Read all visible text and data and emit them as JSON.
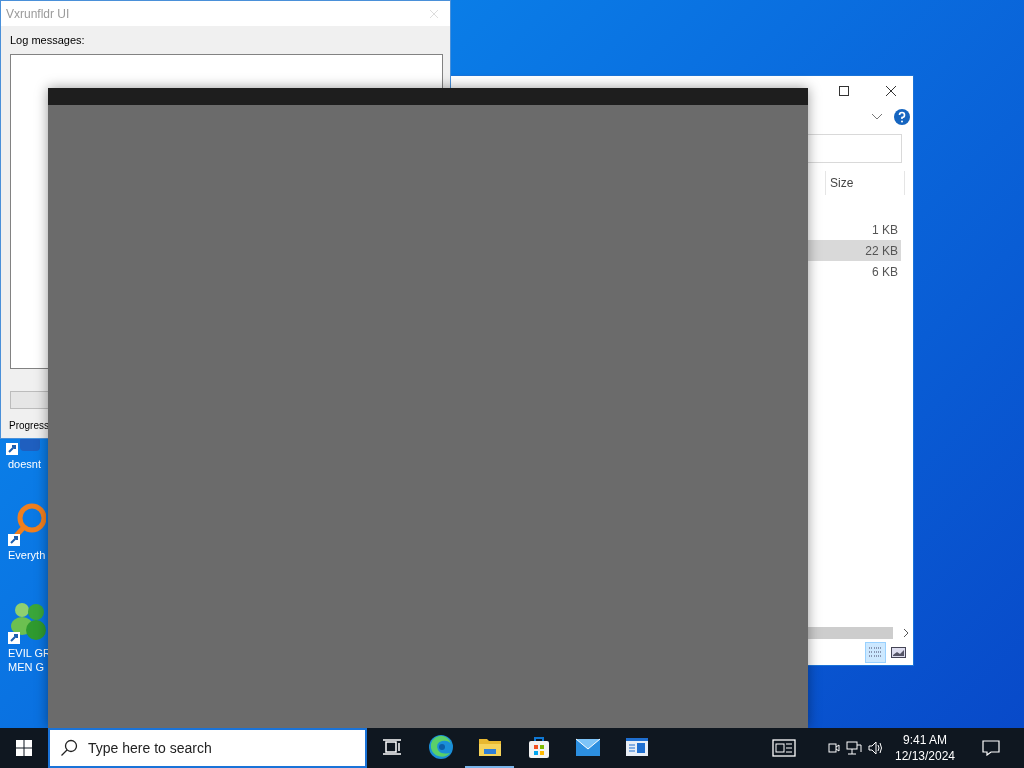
{
  "desktop_icons": [
    {
      "lines": [
        "doesnt"
      ],
      "kind": "blue"
    },
    {
      "lines": [
        "Everyth"
      ],
      "kind": "search"
    },
    {
      "lines": [
        "EVIL GR",
        "MEN G"
      ],
      "kind": "people"
    }
  ],
  "log_window": {
    "title": "Vxrunfldr UI",
    "log_label": "Log messages:",
    "progress_label": "Progress"
  },
  "explorer": {
    "column": "Size",
    "rows": [
      {
        "size": "1 KB",
        "selected": false
      },
      {
        "size": "22 KB",
        "selected": true
      },
      {
        "size": "6 KB",
        "selected": false
      }
    ],
    "views": [
      {
        "kind": "details",
        "selected": true
      },
      {
        "kind": "thumbnails",
        "selected": false
      }
    ]
  },
  "taskbar": {
    "search": {
      "placeholder": "Type here to search"
    },
    "apps": [
      {
        "kind": "taskview",
        "active": false
      },
      {
        "kind": "edge",
        "active": false
      },
      {
        "kind": "explorer",
        "active": true
      },
      {
        "kind": "store",
        "active": false
      },
      {
        "kind": "mail",
        "active": false
      },
      {
        "kind": "app",
        "active": false
      }
    ],
    "time": "9:41 AM",
    "date": "12/13/2024"
  }
}
